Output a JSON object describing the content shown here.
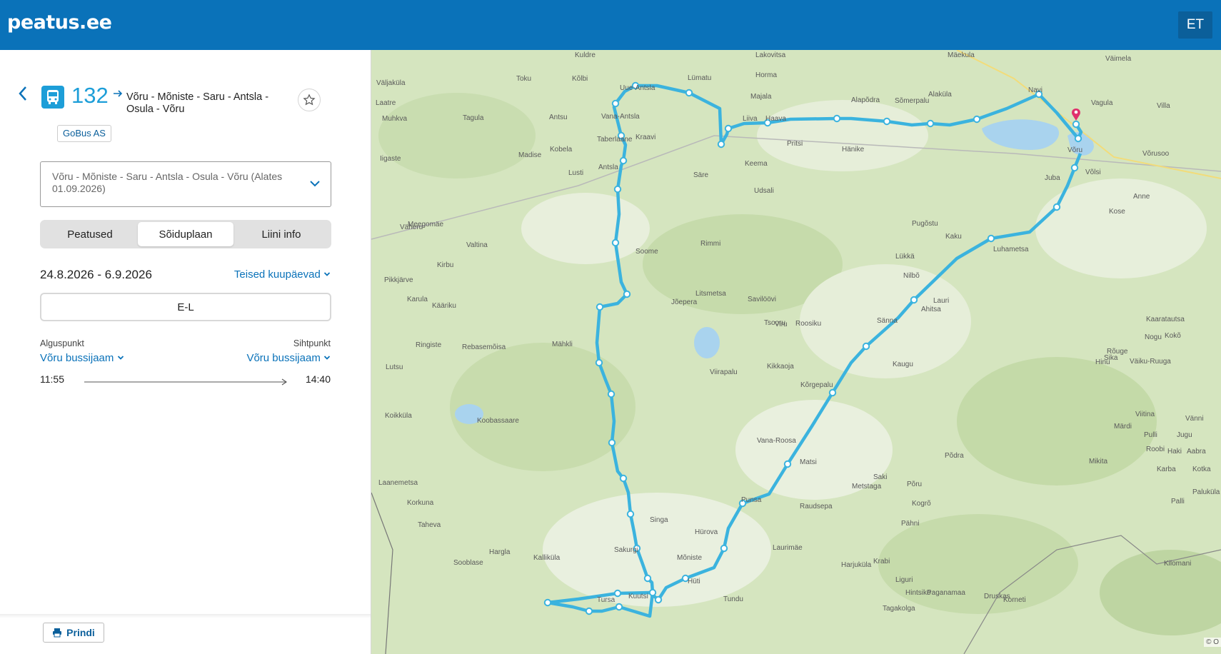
{
  "header": {
    "logo": "peatus.ee",
    "language": "ET"
  },
  "route": {
    "number": "132",
    "name": "Võru - Mõniste - Saru - Antsla - Osula - Võru",
    "operator": "GoBus AS",
    "variant": "Võru - Mõniste - Saru - Antsla - Osula - Võru (Alates 01.09.2026)"
  },
  "tabs": [
    {
      "label": "Peatused"
    },
    {
      "label": "Sõiduplaan"
    },
    {
      "label": "Liini info"
    }
  ],
  "schedule": {
    "date_range": "24.8.2026 - 6.9.2026",
    "other_dates": "Teised kuupäevad",
    "days": "E-L",
    "from_label": "Alguspunkt",
    "to_label": "Sihtpunkt",
    "from_stop": "Võru bussijaam",
    "to_stop": "Võru bussijaam",
    "departure": "11:55",
    "arrival": "14:40"
  },
  "footer": {
    "print": "Prindi"
  },
  "map": {
    "copyright": "© O",
    "route_color": "#3bb3de",
    "labels": [
      "Kuldre",
      "Toku",
      "Kõlbi",
      "Uue-Antsla",
      "Lümatu",
      "Lakovitsa",
      "Horma",
      "Mäekula",
      "Väimela",
      "Väljaküla",
      "Laatre",
      "Muhkva",
      "Tagula",
      "Antsu",
      "Vana-Antsla",
      "Majala",
      "Alapõdra",
      "Sõmerpalu",
      "Alaküla",
      "Navi",
      "Vagula",
      "Villa",
      "Liiva",
      "Haava",
      "Taberlaane",
      "Kraavi",
      "Pritsi",
      "Hänike",
      "Võru",
      "Võrusoo",
      "Iigaste",
      "Madise",
      "Kobela",
      "Lusti",
      "Antsla",
      "Säre",
      "Keema",
      "Udsali",
      "Juba",
      "Võlsi",
      "Anne",
      "Kose",
      "Meegomäe",
      "Väheru",
      "Valtina",
      "Soome",
      "Rimmi",
      "Pugõstu",
      "Kaku",
      "Luhametsa",
      "Lükkä",
      "Nilbõ",
      "Kirbu",
      "Pikkjärve",
      "Karula",
      "Kääriku",
      "Jõepera",
      "Litsmetsa",
      "Savilöövi",
      "Lauri",
      "Ahitsa",
      "Kaaratautsa",
      "Sänna",
      "Viru",
      "Roosiku",
      "Tsooru",
      "Nogu",
      "Kokõ",
      "Ringiste",
      "Rebasemõisa",
      "Mähkli",
      "Viirapalu",
      "Kikkaoja",
      "Hinu",
      "Kaugu",
      "Rõuge",
      "Väiku-Ruuga",
      "Sika",
      "Lutsu",
      "Kõrgepalu",
      "Koikküla",
      "Koobassaare",
      "Vana-Roosa",
      "Märdi",
      "Viitina",
      "Pulli",
      "Jugu",
      "Vänni",
      "Roobi",
      "Haki",
      "Aabra",
      "Põdra",
      "Matsi",
      "Mikita",
      "Karba",
      "Kotka",
      "Laanemetsa",
      "Korkuna",
      "Taheva",
      "Metstaga",
      "Punsa",
      "Raudsepa",
      "Saki",
      "Põru",
      "Kogrõ",
      "Palli",
      "Paluküla",
      "Singa",
      "Hürova",
      "Pähni",
      "Hargla",
      "Kalliküla",
      "Sooblase",
      "Sakurgi",
      "Mõniste",
      "Laurimäe",
      "Hüti",
      "Harjuküla",
      "Krabi",
      "Kilomani",
      "Tursa",
      "Kuutsi",
      "Tundu",
      "Hintsiko",
      "Tagakolga",
      "Liguri",
      "Paganamaa",
      "Druskas",
      "Korneti"
    ]
  }
}
